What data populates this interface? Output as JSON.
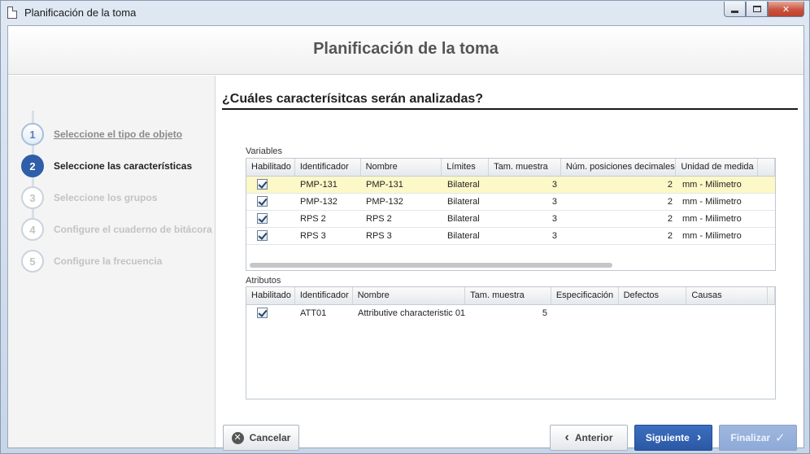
{
  "window": {
    "title": "Planificación de la toma"
  },
  "header": {
    "title": "Planificación de la toma"
  },
  "steps": [
    {
      "num": "1",
      "label": "Seleccione el tipo de objeto",
      "state": "done"
    },
    {
      "num": "2",
      "label": "Seleccione las características",
      "state": "active"
    },
    {
      "num": "3",
      "label": "Seleccione los grupos",
      "state": "pending"
    },
    {
      "num": "4",
      "label": "Configure el cuaderno de bitácora",
      "state": "pending"
    },
    {
      "num": "5",
      "label": "Configure la frecuencia",
      "state": "pending"
    }
  ],
  "main": {
    "question": "¿Cuáles caracterísitcas serán analizadas?"
  },
  "variables": {
    "label": "Variables",
    "columns": [
      "Habilitado",
      "Identificador",
      "Nombre",
      "Límites",
      "Tam. muestra",
      "Núm. posiciones decimales",
      "Unidad de medida"
    ],
    "rows": [
      {
        "enabled": true,
        "id": "PMP-131",
        "name": "PMP-131",
        "limits": "Bilateral",
        "sample": "3",
        "decimals": "2",
        "unit": "mm - Milimetro"
      },
      {
        "enabled": true,
        "id": "PMP-132",
        "name": "PMP-132",
        "limits": "Bilateral",
        "sample": "3",
        "decimals": "2",
        "unit": "mm - Milimetro"
      },
      {
        "enabled": true,
        "id": "RPS 2",
        "name": "RPS 2",
        "limits": "Bilateral",
        "sample": "3",
        "decimals": "2",
        "unit": "mm - Milimetro"
      },
      {
        "enabled": true,
        "id": "RPS 3",
        "name": "RPS 3",
        "limits": "Bilateral",
        "sample": "3",
        "decimals": "2",
        "unit": "mm - Milimetro"
      }
    ]
  },
  "attributes": {
    "label": "Atributos",
    "columns": [
      "Habilitado",
      "Identificador",
      "Nombre",
      "Tam. muestra",
      "Especificación",
      "Defectos",
      "Causas"
    ],
    "rows": [
      {
        "enabled": true,
        "id": "ATT01",
        "name": "Attributive characteristic 01",
        "sample": "5",
        "spec": "",
        "defects": "",
        "causes": ""
      }
    ]
  },
  "buttons": {
    "cancel": "Cancelar",
    "previous": "Anterior",
    "next": "Siguiente",
    "finish": "Finalizar"
  },
  "colors": {
    "primary": "#2b58a5",
    "selected_row": "#fdf8c8",
    "disabled": "#8eaad8"
  }
}
